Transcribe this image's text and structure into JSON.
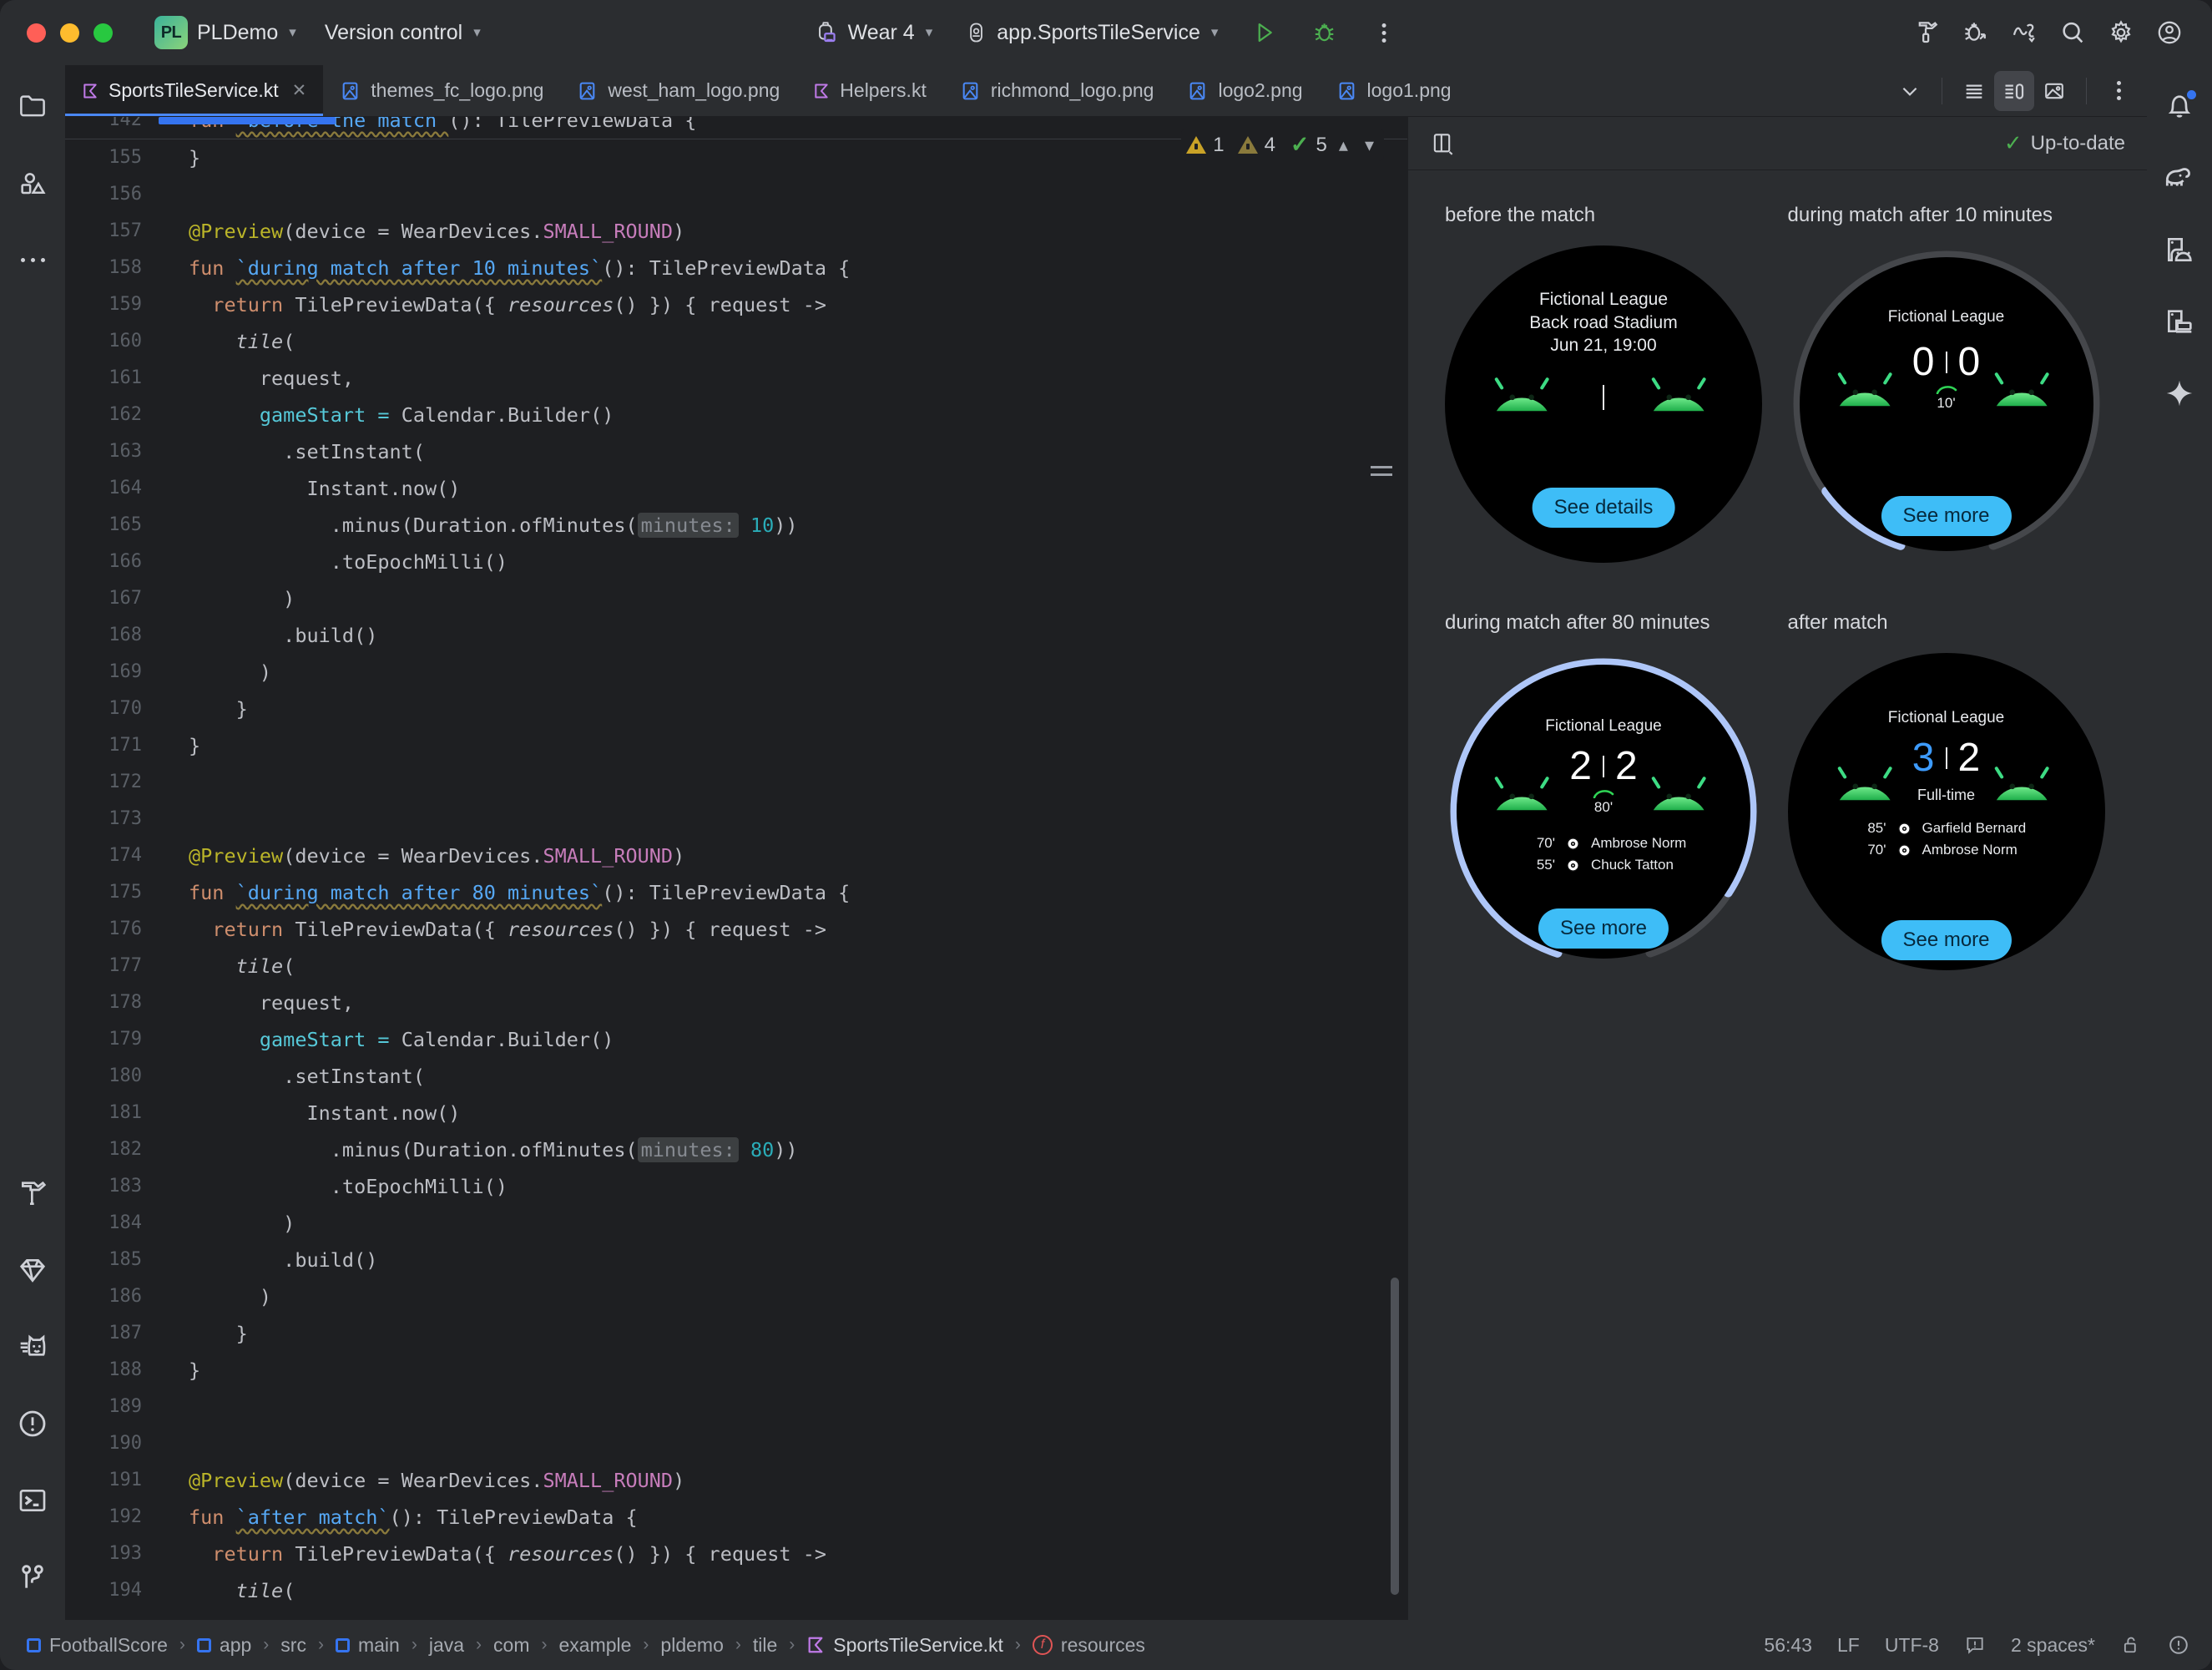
{
  "titlebar": {
    "project_badge": "PL",
    "project_name": "PLDemo",
    "version_control": "Version control",
    "device": "Wear 4",
    "run_config": "app.SportsTileService",
    "icons": {
      "run": "run-icon",
      "debug": "debug-icon",
      "more": "more-actions-icon",
      "build": "build-icon",
      "profile": "profiler-icon",
      "device_manager": "device-manager-icon",
      "search": "search-icon",
      "settings": "gear-icon",
      "account": "account-icon"
    }
  },
  "tabs": [
    {
      "label": "SportsTileService.kt",
      "icon": "kotlin-file-icon",
      "active": true,
      "closable": true
    },
    {
      "label": "themes_fc_logo.png",
      "icon": "image-file-icon",
      "active": false,
      "closable": false
    },
    {
      "label": "west_ham_logo.png",
      "icon": "image-file-icon",
      "active": false,
      "closable": false
    },
    {
      "label": "Helpers.kt",
      "icon": "kotlin-file-icon",
      "active": false,
      "closable": false
    },
    {
      "label": "richmond_logo.png",
      "icon": "image-file-icon",
      "active": false,
      "closable": false
    },
    {
      "label": "logo2.png",
      "icon": "image-file-icon",
      "active": false,
      "closable": false
    },
    {
      "label": "logo1.png",
      "icon": "image-file-icon",
      "active": false,
      "closable": false
    }
  ],
  "tab_controls": {
    "overflow": "chevron-down-icon",
    "list_view": "list-view-icon",
    "split_view": "split-view-icon",
    "gallery_view": "gallery-view-icon",
    "more": "more-options-icon"
  },
  "editor": {
    "inspections": {
      "warnings_primary": "1",
      "warnings_secondary": "4",
      "checks": "5",
      "prev": "chevron-up-icon",
      "next": "chevron-down-icon"
    },
    "first_visible_line": 142,
    "lines": [
      {
        "n": 142,
        "clipped": true
      },
      {
        "n": 155
      },
      {
        "n": 156
      },
      {
        "n": 157
      },
      {
        "n": 158
      },
      {
        "n": 159
      },
      {
        "n": 160
      },
      {
        "n": 161
      },
      {
        "n": 162
      },
      {
        "n": 163
      },
      {
        "n": 164
      },
      {
        "n": 165
      },
      {
        "n": 166
      },
      {
        "n": 167
      },
      {
        "n": 168
      },
      {
        "n": 169
      },
      {
        "n": 170
      },
      {
        "n": 171
      },
      {
        "n": 172
      },
      {
        "n": 173
      },
      {
        "n": 174
      },
      {
        "n": 175
      },
      {
        "n": 176
      },
      {
        "n": 177
      },
      {
        "n": 178
      },
      {
        "n": 179
      },
      {
        "n": 180
      },
      {
        "n": 181
      },
      {
        "n": 182
      },
      {
        "n": 183
      },
      {
        "n": 184
      },
      {
        "n": 185
      },
      {
        "n": 186
      },
      {
        "n": 187
      },
      {
        "n": 188
      },
      {
        "n": 189
      },
      {
        "n": 190
      },
      {
        "n": 191
      },
      {
        "n": 192
      },
      {
        "n": 193
      },
      {
        "n": 194
      }
    ],
    "param_hint_10": "minutes:",
    "param_hint_80": "minutes:",
    "value_10": "10",
    "value_80": "80"
  },
  "preview": {
    "panel_icon": "preview-layout-icon",
    "status": "Up-to-date",
    "status_icon": "check-icon",
    "tiles": [
      {
        "label": "before the match",
        "league": "Fictional League",
        "stadium": "Back road Stadium",
        "datetime": "Jun 21, 19:00",
        "button": "See details",
        "has_score": false,
        "progress": 0,
        "events": []
      },
      {
        "label": "during match after 10 minutes",
        "league": "Fictional League",
        "home_score": "0",
        "away_score": "0",
        "minute": "10'",
        "button": "See more",
        "has_score": true,
        "progress": 11,
        "events": []
      },
      {
        "label": "during match after 80 minutes",
        "league": "Fictional League",
        "home_score": "2",
        "away_score": "2",
        "minute": "80'",
        "button": "See more",
        "has_score": true,
        "progress": 88,
        "events": [
          {
            "time": "70'",
            "player": "Ambrose Norm"
          },
          {
            "time": "55'",
            "player": "Chuck Tatton"
          }
        ]
      },
      {
        "label": "after match",
        "league": "Fictional League",
        "home_score": "3",
        "away_score": "2",
        "minute": "Full-time",
        "button": "See more",
        "has_score": true,
        "progress": 0,
        "winner": "home",
        "events": [
          {
            "time": "85'",
            "player": "Garfield Bernard"
          },
          {
            "time": "70'",
            "player": "Ambrose Norm"
          }
        ]
      }
    ]
  },
  "statusbar": {
    "breadcrumbs": [
      {
        "label": "FootballScore",
        "icon": "module-icon"
      },
      {
        "label": "app",
        "icon": "module-icon"
      },
      {
        "label": "src",
        "icon": ""
      },
      {
        "label": "main",
        "icon": "module-icon"
      },
      {
        "label": "java",
        "icon": ""
      },
      {
        "label": "com",
        "icon": ""
      },
      {
        "label": "example",
        "icon": ""
      },
      {
        "label": "pldemo",
        "icon": ""
      },
      {
        "label": "tile",
        "icon": ""
      },
      {
        "label": "SportsTileService.kt",
        "icon": "kotlin-file-icon"
      },
      {
        "label": "resources",
        "icon": "function-icon"
      }
    ],
    "caret": "56:43",
    "line_sep": "LF",
    "encoding": "UTF-8",
    "indent": "2 spaces*",
    "read_mode_icon": "read-mode-icon",
    "lock_icon": "unlocked-icon",
    "inspection_icon": "inspection-icon"
  },
  "left_rail": [
    {
      "icon": "project-folder-icon",
      "name": "project"
    },
    {
      "icon": "resource-manager-icon",
      "name": "resource-manager"
    },
    {
      "icon": "more-tool-windows-icon",
      "name": "more-tool-windows"
    },
    {
      "icon": "build-hammer-icon",
      "name": "build"
    },
    {
      "icon": "gemini-diamond-icon",
      "name": "gemini"
    },
    {
      "icon": "logcat-cat-icon",
      "name": "logcat"
    },
    {
      "icon": "problems-icon",
      "name": "problems"
    },
    {
      "icon": "terminal-icon",
      "name": "terminal"
    },
    {
      "icon": "version-control-branch-icon",
      "name": "version-control"
    }
  ],
  "right_rail": [
    {
      "icon": "notifications-bell-icon",
      "name": "notifications",
      "badge": true
    },
    {
      "icon": "gradle-elephant-icon",
      "name": "gradle"
    },
    {
      "icon": "running-devices-icon",
      "name": "running-devices"
    },
    {
      "icon": "device-manager-icon",
      "name": "device-manager"
    },
    {
      "icon": "gemini-sparkle-icon",
      "name": "gemini-assistant"
    }
  ],
  "colors": {
    "accent_blue": "#3574f0",
    "tile_button": "#3ebdf7",
    "progress_arc": "#aec6f8",
    "android_green": "#3ddc84",
    "warn_yellow": "#c9a227",
    "ok_green": "#4caf50"
  }
}
